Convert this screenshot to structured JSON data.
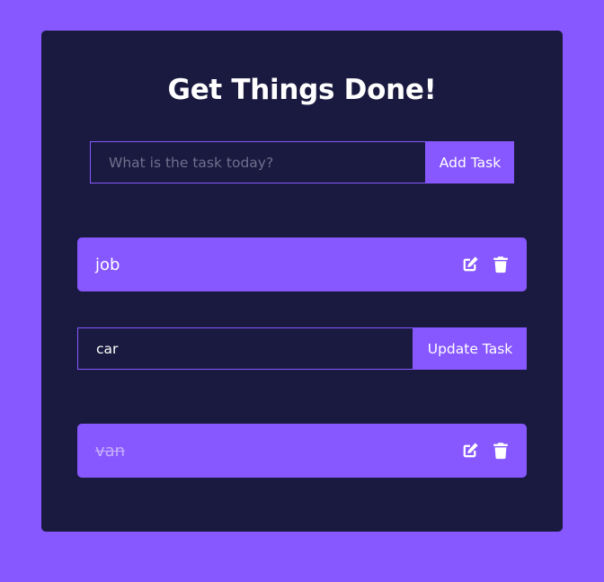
{
  "app": {
    "title": "Get Things Done!"
  },
  "add_form": {
    "placeholder": "What is the task today?",
    "value": "",
    "button_label": "Add Task"
  },
  "todos": [
    {
      "text": "job",
      "completed": false,
      "editing": false
    },
    {
      "text": "car",
      "completed": false,
      "editing": true
    },
    {
      "text": "van",
      "completed": true,
      "editing": false
    }
  ],
  "edit_form": {
    "value": "car",
    "button_label": "Update Task"
  },
  "icons": {
    "edit": "edit-icon",
    "delete": "trash-icon"
  },
  "colors": {
    "background": "#8758ff",
    "card": "#1a1a40",
    "accent": "#8758ff",
    "text": "#ffffff",
    "completed_text": "#c5aeff",
    "placeholder": "#6f6f8d"
  }
}
